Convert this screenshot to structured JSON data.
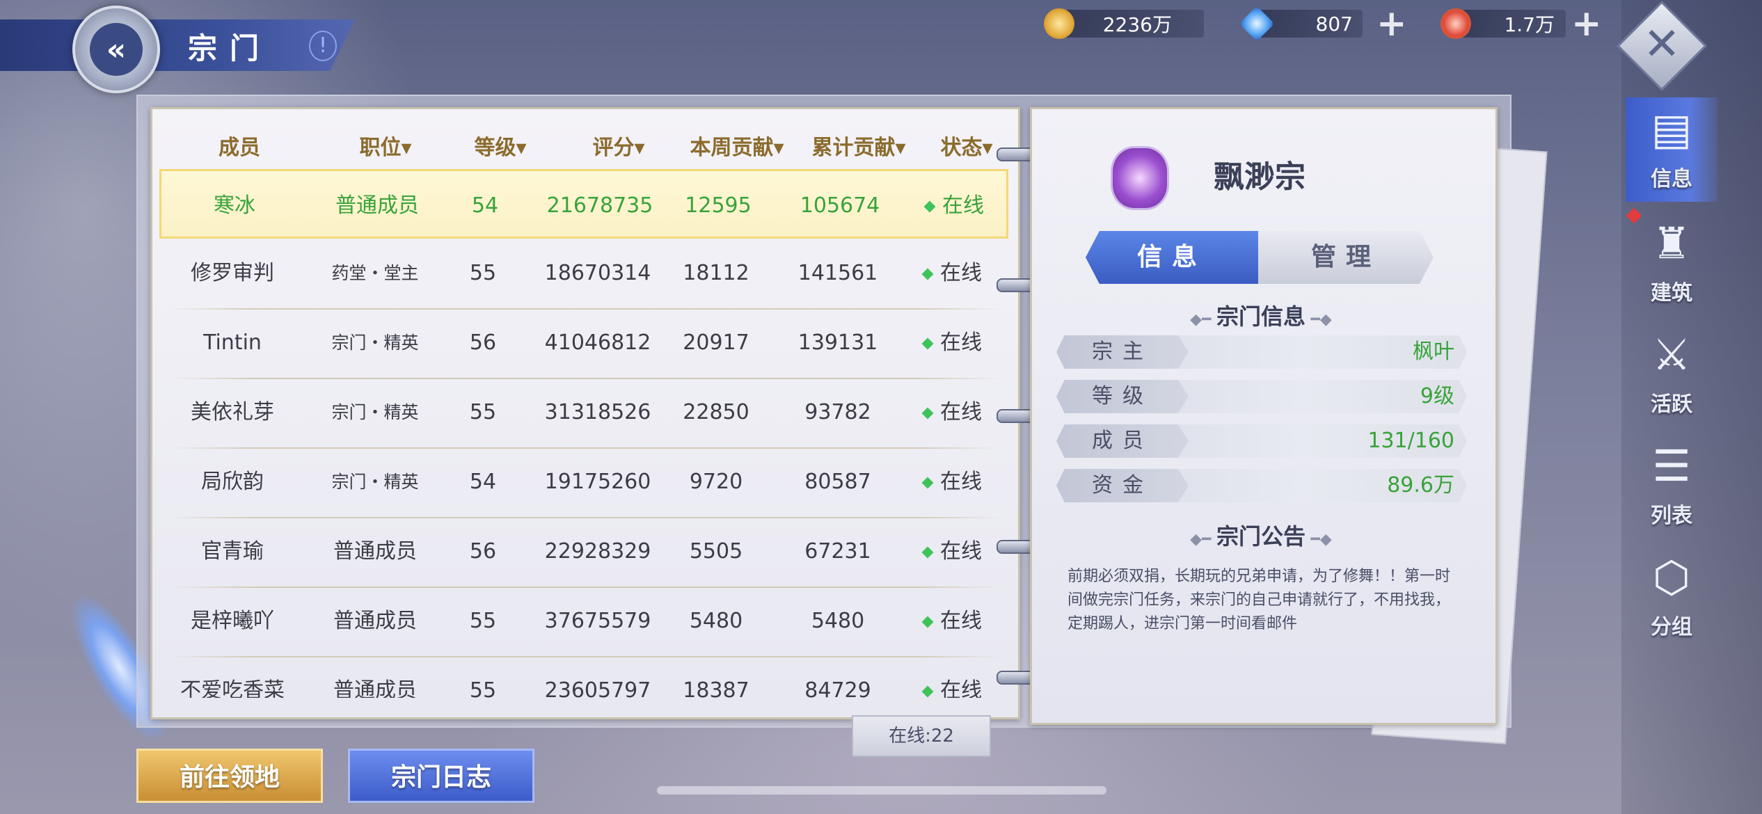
{
  "header": {
    "title": "宗门",
    "info_icon": "!"
  },
  "currencies": [
    {
      "icon": "gold-coin-icon",
      "value": "2236万",
      "has_plus": false
    },
    {
      "icon": "diamond-icon",
      "value": "807",
      "has_plus": true
    },
    {
      "icon": "ruby-icon",
      "value": "1.7万",
      "has_plus": true
    }
  ],
  "side_tabs": [
    {
      "label": "信息",
      "icon": "scroll-icon",
      "active": true
    },
    {
      "label": "建筑",
      "icon": "castle-icon",
      "active": false
    },
    {
      "label": "活跃",
      "icon": "sword-icon",
      "active": false
    },
    {
      "label": "列表",
      "icon": "list-icon",
      "active": false
    },
    {
      "label": "分组",
      "icon": "group-icon",
      "active": false
    }
  ],
  "table": {
    "headers": [
      "成员",
      "职位▾",
      "等级▾",
      "评分▾",
      "本周贡献▾",
      "累计贡献▾",
      "状态▾"
    ],
    "rows": [
      {
        "name": "寒冰",
        "role": "普通成员",
        "level": "54",
        "score": "21678735",
        "week": "12595",
        "total": "105674",
        "status": "在线"
      },
      {
        "name": "修罗审判",
        "role": "药堂・堂主",
        "level": "55",
        "score": "18670314",
        "week": "18112",
        "total": "141561",
        "status": "在线"
      },
      {
        "name": "Tintin",
        "role": "宗门・精英",
        "level": "56",
        "score": "41046812",
        "week": "20917",
        "total": "139131",
        "status": "在线"
      },
      {
        "name": "美依礼芽",
        "role": "宗门・精英",
        "level": "55",
        "score": "31318526",
        "week": "22850",
        "total": "93782",
        "status": "在线"
      },
      {
        "name": "局欣韵",
        "role": "宗门・精英",
        "level": "54",
        "score": "19175260",
        "week": "9720",
        "total": "80587",
        "status": "在线"
      },
      {
        "name": "官青瑜",
        "role": "普通成员",
        "level": "56",
        "score": "22928329",
        "week": "5505",
        "total": "67231",
        "status": "在线"
      },
      {
        "name": "是梓曦吖",
        "role": "普通成员",
        "level": "55",
        "score": "37675579",
        "week": "5480",
        "total": "5480",
        "status": "在线"
      },
      {
        "name": "不爱吃香菜",
        "role": "普通成员",
        "level": "55",
        "score": "23605797",
        "week": "18387",
        "total": "84729",
        "status": "在线"
      }
    ]
  },
  "sect": {
    "name": "飘渺宗",
    "tabs": [
      "信息",
      "管理"
    ],
    "info_title": "宗门信息",
    "info": [
      {
        "key": "宗主",
        "value": "枫叶"
      },
      {
        "key": "等级",
        "value": "9级"
      },
      {
        "key": "成员",
        "value": "131/160"
      },
      {
        "key": "资金",
        "value": "89.6万"
      }
    ],
    "notice_title": "宗门公告",
    "notice": "前期必须双捐，长期玩的兄弟申请，为了修舞！！第一时间做完宗门任务，来宗门的自己申请就行了，不用找我，定期踢人，进宗门第一时间看邮件"
  },
  "online_count": "在线:22",
  "buttons": {
    "territory": "前往领地",
    "log": "宗门日志"
  }
}
